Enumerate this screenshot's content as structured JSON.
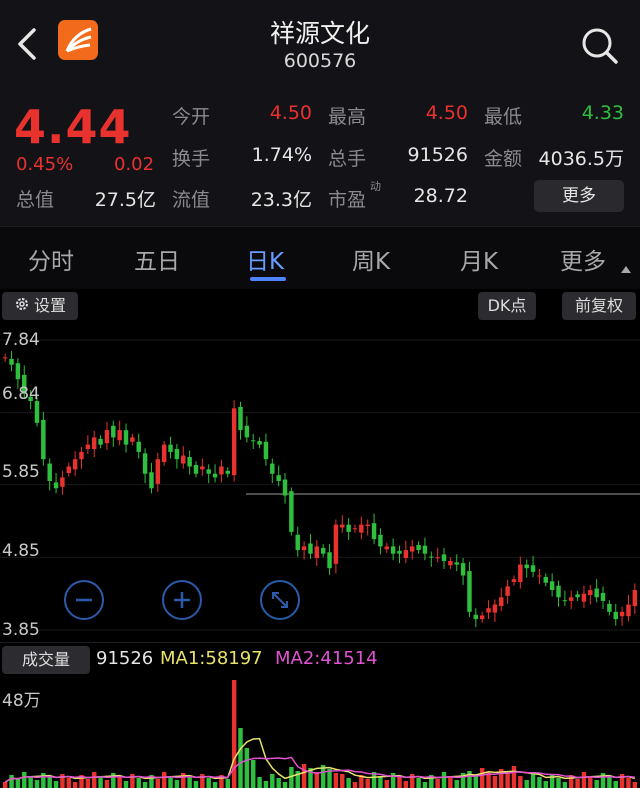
{
  "header": {
    "stock_name": "祥源文化",
    "stock_code": "600576",
    "back_icon": "back-chevron-icon",
    "app_icon": "app-logo-icon",
    "search_icon": "search-icon"
  },
  "quote": {
    "price": "4.44",
    "change_pct": "0.45%",
    "change_amt": "0.02",
    "fields": {
      "open_label": "今开",
      "open_value": "4.50",
      "high_label": "最高",
      "high_value": "4.50",
      "low_label": "最低",
      "low_value": "4.33",
      "turnover_label": "换手",
      "turnover_value": "1.74%",
      "volume_label": "总手",
      "volume_value": "91526",
      "amount_label": "金额",
      "amount_value": "4036.5万",
      "mktcap_label": "总值",
      "mktcap_value": "27.5亿",
      "float_label": "流值",
      "float_value": "23.3亿",
      "pe_label": "市盈",
      "pe_sup": "动",
      "pe_value": "28.72"
    },
    "more_button": "更多",
    "colors": {
      "up": "#e8322e",
      "down": "#2fbf3e"
    }
  },
  "tabs": {
    "items": [
      "分时",
      "五日",
      "日K",
      "周K",
      "月K",
      "更多"
    ],
    "active": "日K"
  },
  "chart_toolbar": {
    "settings_label": "设置",
    "settings_icon": "gear-icon",
    "dk_label": "DK点",
    "adjust_label": "前复权"
  },
  "chart_data": {
    "type": "candlestick",
    "y_ticks": [
      "7.84",
      "6.84",
      "5.85",
      "4.85",
      "3.85"
    ],
    "ylim": [
      3.85,
      7.84
    ],
    "close_approx": [
      7.6,
      7.5,
      7.3,
      7.1,
      7.0,
      6.7,
      6.2,
      5.9,
      5.8,
      5.95,
      6.1,
      6.2,
      6.3,
      6.4,
      6.5,
      6.4,
      6.6,
      6.5,
      6.6,
      6.4,
      6.5,
      6.3,
      6.0,
      5.8,
      6.2,
      6.4,
      6.3,
      6.2,
      6.25,
      6.1,
      6.0,
      6.1,
      6.0,
      5.95,
      6.1,
      6.0,
      6.9,
      6.6,
      6.5,
      6.45,
      6.4,
      6.2,
      6.0,
      5.9,
      5.7,
      5.2,
      4.95,
      5.0,
      4.9,
      5.0,
      4.9,
      4.7,
      5.3,
      5.3,
      5.2,
      5.25,
      5.3,
      5.3,
      5.1,
      5.0,
      5.0,
      4.9,
      4.9,
      4.95,
      5.0,
      4.95,
      4.9,
      4.85,
      4.85,
      4.8,
      4.8,
      4.75,
      4.6,
      4.1,
      4.0,
      4.05,
      4.15,
      4.2,
      4.3,
      4.45,
      4.55,
      4.75,
      4.7,
      4.65,
      4.6,
      4.5,
      4.4,
      4.3,
      4.25,
      4.3,
      4.3,
      4.35,
      4.4,
      4.3,
      4.25,
      4.1,
      4.0,
      4.1,
      4.2,
      4.4
    ]
  },
  "chart_controls": {
    "zoom_out_icon": "zoom-out-icon",
    "zoom_in_icon": "zoom-in-icon",
    "fullscreen_icon": "fullscreen-icon"
  },
  "volume": {
    "label": "成交量",
    "value": "91526",
    "ma1": "MA1:58197",
    "ma2": "MA2:41514",
    "top_tick": "48万",
    "ma1_color": "#e9e36a",
    "ma2_color": "#e052d2"
  }
}
